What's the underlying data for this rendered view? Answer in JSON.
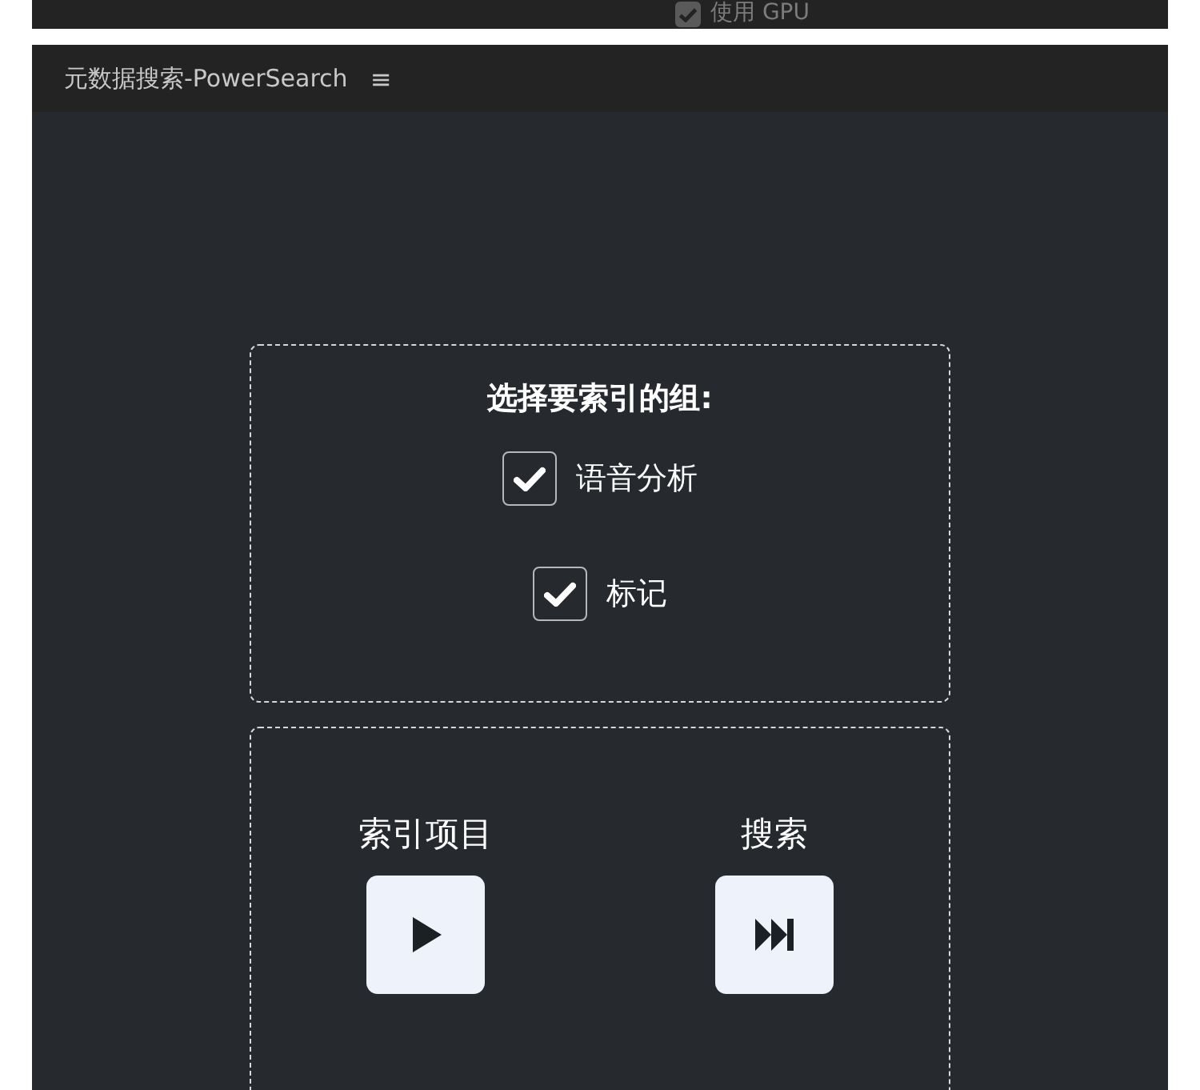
{
  "top_bar": {
    "gpu_checkbox": {
      "label": "使用 GPU",
      "checked": true
    }
  },
  "panel": {
    "title": "元数据搜索-PowerSearch",
    "menu_icon": "≡"
  },
  "groups": {
    "heading": "选择要索引的组:",
    "items": [
      {
        "label": "语音分析",
        "checked": true
      },
      {
        "label": "标记",
        "checked": true
      }
    ]
  },
  "actions": [
    {
      "label": "索引项目",
      "kind": "play"
    },
    {
      "label": "搜索",
      "kind": "skip"
    }
  ]
}
